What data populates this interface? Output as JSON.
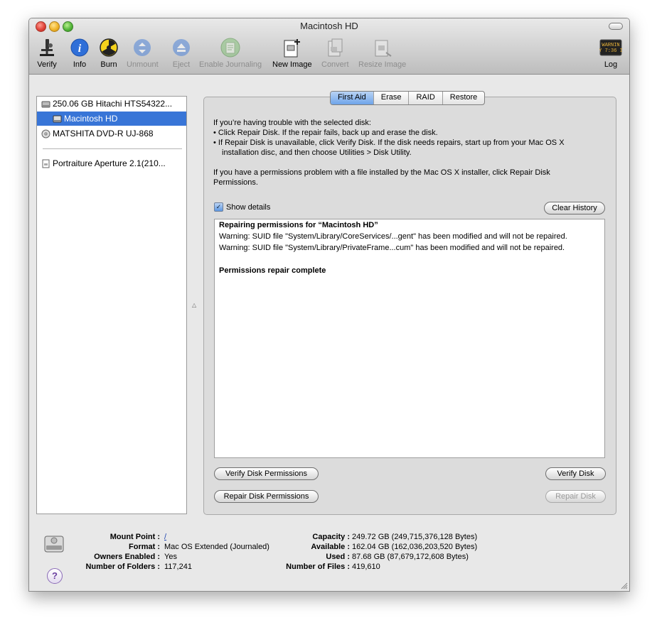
{
  "window": {
    "title": "Macintosh HD"
  },
  "toolbar": {
    "items": [
      {
        "label": "Verify",
        "icon": "microscope-icon",
        "enabled": true
      },
      {
        "label": "Info",
        "icon": "info-icon",
        "enabled": true
      },
      {
        "label": "Burn",
        "icon": "burn-icon",
        "enabled": true
      },
      {
        "label": "Unmount",
        "icon": "unmount-icon",
        "enabled": false
      },
      {
        "label": "Eject",
        "icon": "eject-icon",
        "enabled": false
      },
      {
        "label": "Enable Journaling",
        "icon": "journaling-icon",
        "enabled": false
      },
      {
        "label": "New Image",
        "icon": "new-image-icon",
        "enabled": true
      },
      {
        "label": "Convert",
        "icon": "convert-icon",
        "enabled": false
      },
      {
        "label": "Resize Image",
        "icon": "resize-image-icon",
        "enabled": false
      }
    ],
    "log": {
      "label": "Log",
      "icon_text": "WARNIN\nY 7:36 I"
    }
  },
  "sidebar": {
    "items": [
      {
        "label": "250.06 GB Hitachi HTS54322...",
        "icon": "hard-disk-icon"
      },
      {
        "label": "Macintosh HD",
        "icon": "volume-icon",
        "selected": true
      },
      {
        "label": "MATSHITA DVD-R UJ-868",
        "icon": "optical-drive-icon"
      },
      {
        "label": "Portraiture Aperture 2.1(210...",
        "icon": "disk-image-icon"
      }
    ]
  },
  "tabs": [
    "First Aid",
    "Erase",
    "RAID",
    "Restore"
  ],
  "first_aid": {
    "intro": "If you’re having trouble with the selected disk:",
    "bullet1": "•  Click Repair Disk. If the repair fails, back up and erase the disk.",
    "bullet2a": "•  If Repair Disk is unavailable, click Verify Disk. If the disk needs repairs, start up from your Mac OS X",
    "bullet2b": "installation disc, and then choose Utilities > Disk Utility.",
    "perm1": "If you have a permissions problem with a file installed by the Mac OS X installer, click Repair Disk",
    "perm2": "Permissions.",
    "show_details": "Show details",
    "clear_history": "Clear History",
    "log": [
      "Repairing permissions for “Macintosh HD”",
      "Warning: SUID file \"System/Library/CoreServices/...gent\" has been modified and will not be repaired.",
      "Warning: SUID file \"System/Library/PrivateFrame...cum\" has been modified and will not be repaired.",
      "Permissions repair complete"
    ],
    "verify_permissions": "Verify Disk Permissions",
    "repair_permissions": "Repair Disk Permissions",
    "verify_disk": "Verify Disk",
    "repair_disk": "Repair Disk"
  },
  "details": {
    "mount_point_label": "Mount Point :",
    "mount_point": "/",
    "format_label": "Format :",
    "format": "Mac OS Extended (Journaled)",
    "owners_label": "Owners Enabled :",
    "owners": "Yes",
    "folders_label": "Number of Folders :",
    "folders": "117,241",
    "capacity_label": "Capacity :",
    "capacity": "249.72 GB (249,715,376,128 Bytes)",
    "available_label": "Available :",
    "available": "162.04 GB (162,036,203,520 Bytes)",
    "used_label": "Used :",
    "used": "87.68 GB (87,679,172,608 Bytes)",
    "files_label": "Number of Files :",
    "files": "419,610"
  }
}
